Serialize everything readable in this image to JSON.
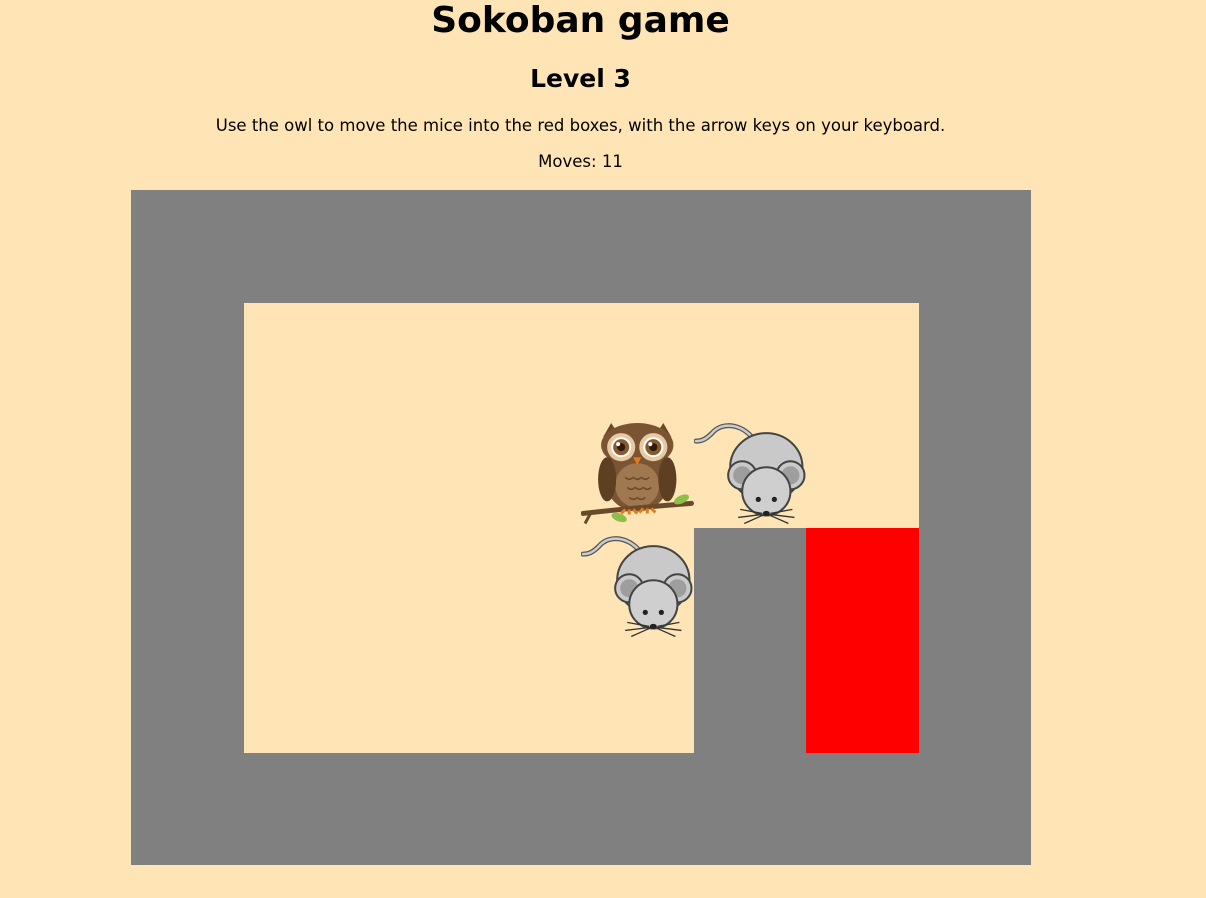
{
  "header": {
    "title": "Sokoban game",
    "level": "Level 3",
    "instructions": "Use the owl to move the mice into the red boxes, with the arrow keys on your keyboard.",
    "moves_label": "Moves:",
    "moves_value": 11
  },
  "colors": {
    "background": "#ffe4b5",
    "wall": "#808080",
    "floor": "#ffe4b5",
    "goal": "#ff0000"
  },
  "board": {
    "rows": 6,
    "cols": 8,
    "grid": [
      "WWWWWWWW",
      "W......W",
      "W......W",
      "W....WGW",
      "W....WGW",
      "WWWWWWWW"
    ],
    "player": {
      "row": 2,
      "col": 4,
      "icon": "owl-icon"
    },
    "boxes": [
      {
        "row": 2,
        "col": 5,
        "icon": "mouse-icon"
      },
      {
        "row": 3,
        "col": 4,
        "icon": "mouse-icon"
      }
    ]
  }
}
